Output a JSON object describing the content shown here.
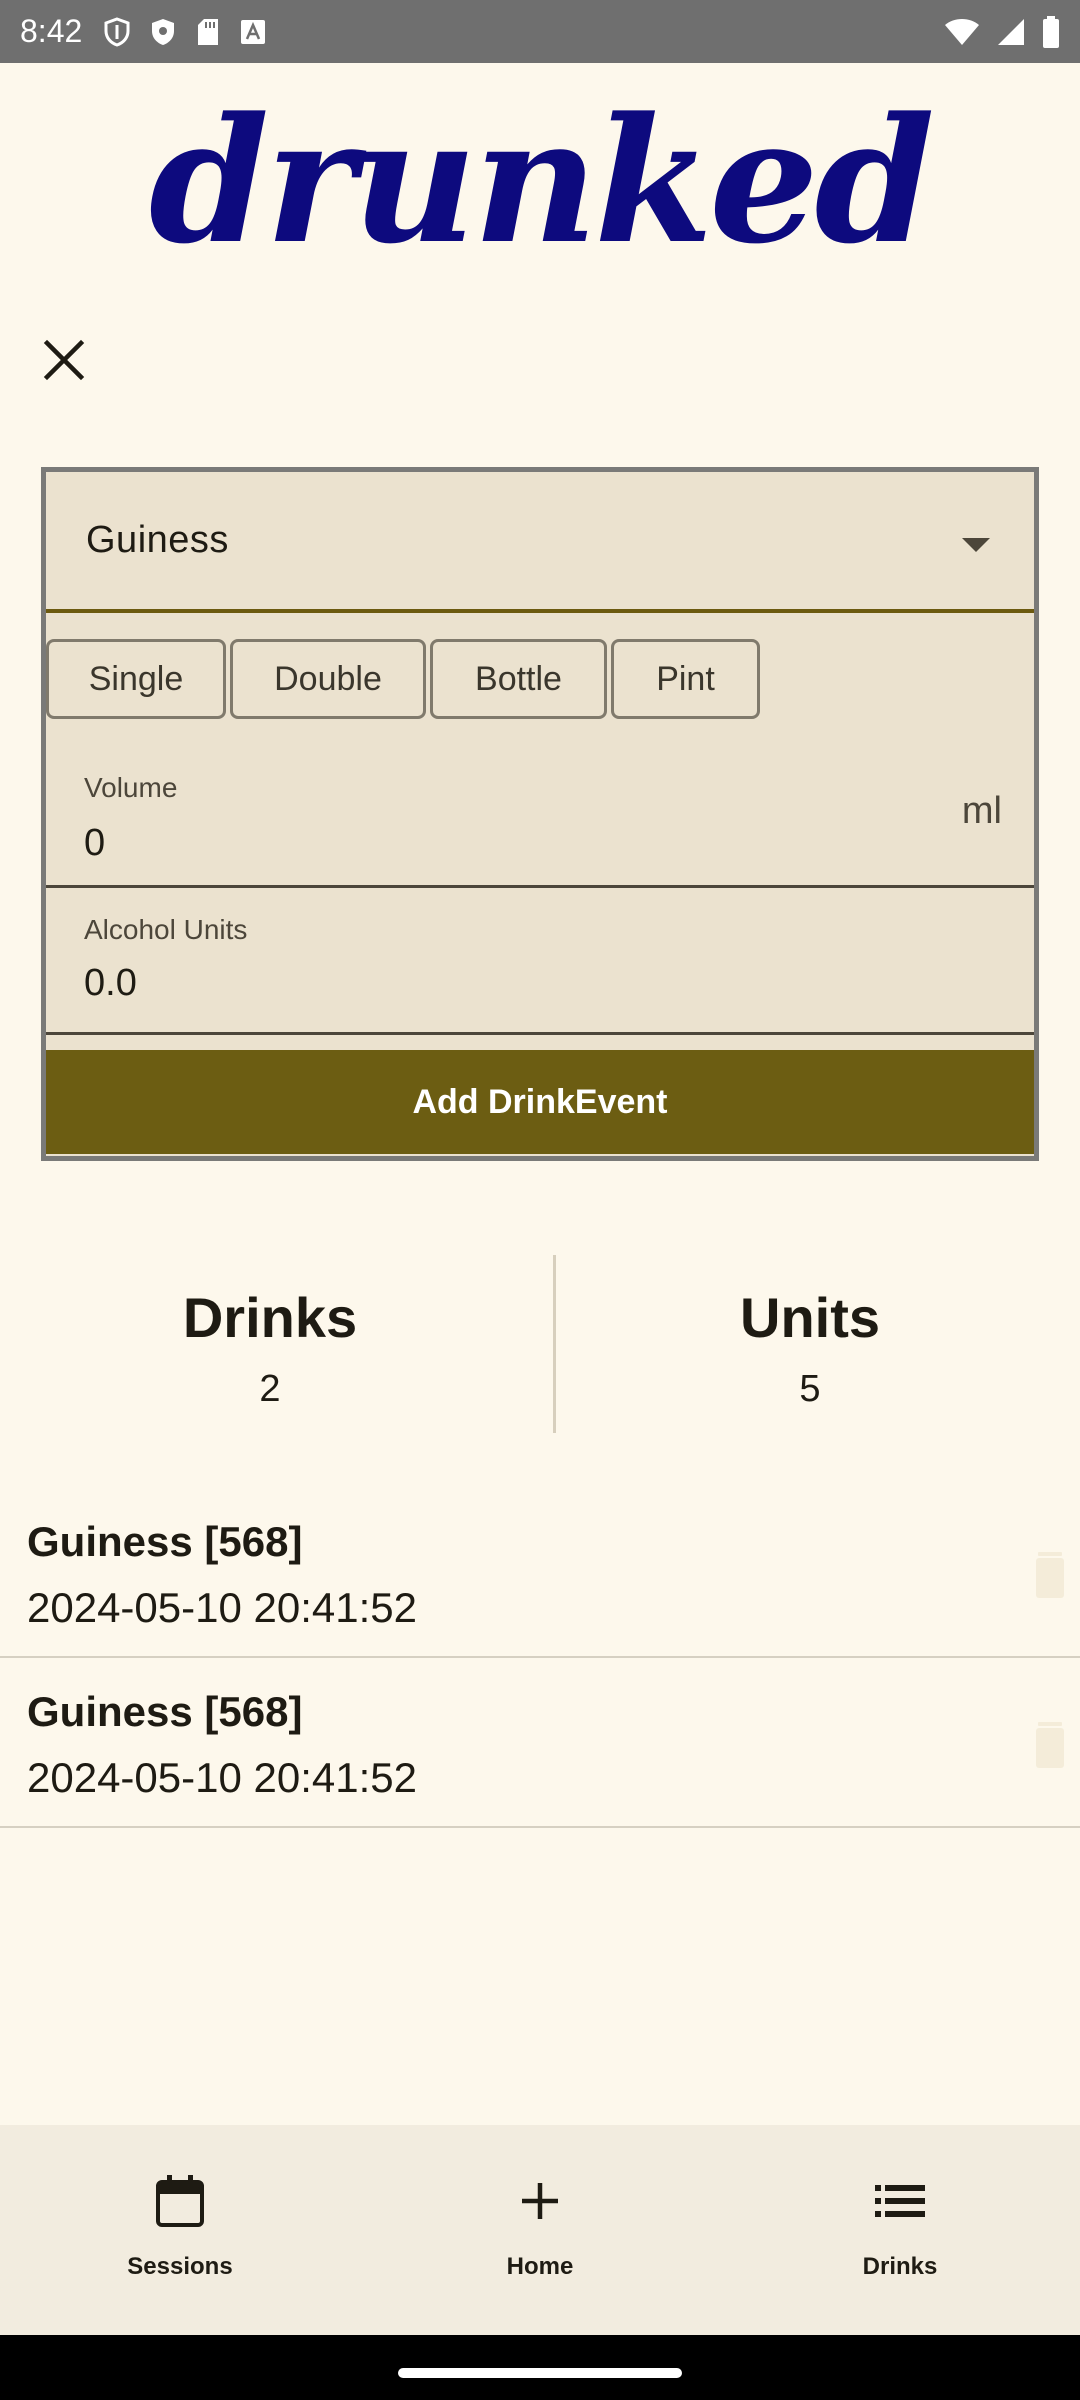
{
  "status_bar": {
    "time": "8:42",
    "icons_left": [
      "shield-outline-icon",
      "shield-icon",
      "sd-card-icon",
      "font-a-icon"
    ],
    "icons_right": [
      "wifi-icon",
      "signal-icon",
      "battery-icon"
    ]
  },
  "app": {
    "logo_text": "drunked",
    "brand_color": "#0d0a7e",
    "accent_color": "#6c5d12"
  },
  "form": {
    "drink_select": "Guiness",
    "presets": [
      "Single",
      "Double",
      "Bottle",
      "Pint"
    ],
    "volume": {
      "label": "Volume",
      "value": "0",
      "suffix": "ml"
    },
    "alcohol_units": {
      "label": "Alcohol Units",
      "value": "0.0"
    },
    "submit_label": "Add DrinkEvent"
  },
  "summary": {
    "drinks": {
      "label": "Drinks",
      "value": "2"
    },
    "units": {
      "label": "Units",
      "value": "5"
    }
  },
  "drink_events": [
    {
      "title": "Guiness [568]",
      "timestamp": "2024-05-10 20:41:52"
    },
    {
      "title": "Guiness [568]",
      "timestamp": "2024-05-10 20:41:52"
    }
  ],
  "bottom_nav": [
    {
      "label": "Sessions",
      "icon": "calendar-icon"
    },
    {
      "label": "Home",
      "icon": "plus-icon"
    },
    {
      "label": "Drinks",
      "icon": "list-icon"
    }
  ]
}
